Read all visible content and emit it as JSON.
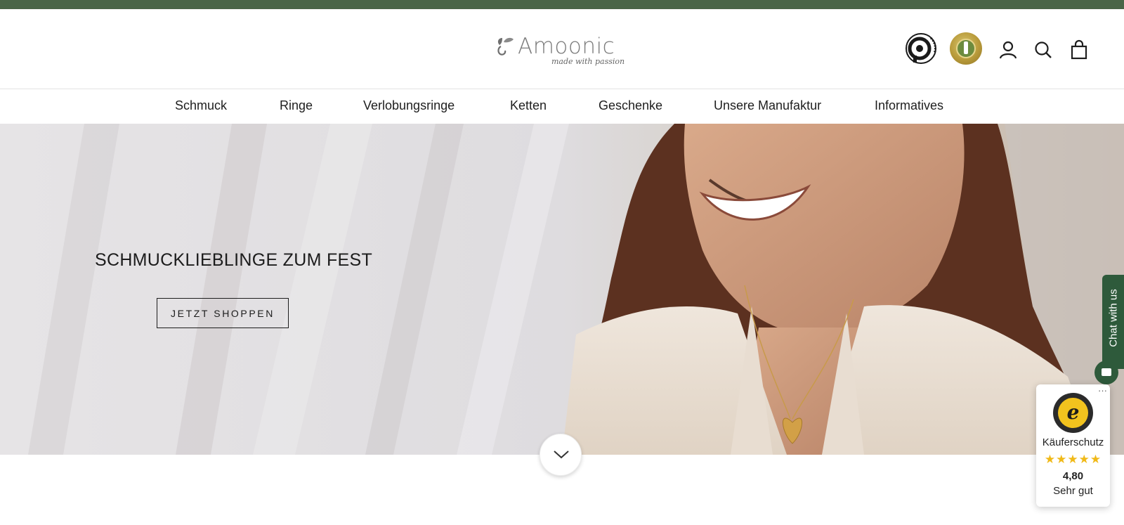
{
  "header": {
    "brand": "Amoonic",
    "tagline": "made with passion"
  },
  "nav": {
    "items": [
      {
        "label": "Schmuck"
      },
      {
        "label": "Ringe"
      },
      {
        "label": "Verlobungsringe"
      },
      {
        "label": "Ketten"
      },
      {
        "label": "Geschenke"
      },
      {
        "label": "Unsere Manufaktur"
      },
      {
        "label": "Informatives"
      }
    ]
  },
  "hero": {
    "title": "SCHMUCKLIEBLINGE ZUM FEST",
    "cta": "JETZT SHOPPEN"
  },
  "chat": {
    "label": "Chat with us"
  },
  "trusted_shops": {
    "more": "···",
    "seal_letter": "e",
    "label": "Käuferschutz",
    "stars": "★★★★★",
    "score": "4,80",
    "grade": "Sehr gut"
  },
  "colors": {
    "top_bar": "#4a6547",
    "chat_green": "#2e5a3b",
    "star": "#f0b917"
  },
  "icons": [
    "account-icon",
    "search-icon",
    "cart-icon",
    "chevron-down-icon",
    "chat-icon"
  ]
}
